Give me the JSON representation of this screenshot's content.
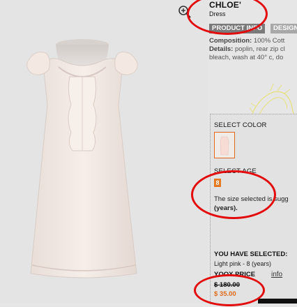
{
  "product": {
    "brand": "CHLOE'",
    "category": "Dress"
  },
  "tabs": {
    "product_info": "PRODUCT INFO",
    "designer": "DESIGNER"
  },
  "details": {
    "composition_label": "Composition:",
    "composition_value": "100% Cott",
    "details_label": "Details:",
    "details_value": "poplin, rear zip cl",
    "care_line": "bleach, wash at 40° c, do"
  },
  "select_color": {
    "label": "SELECT COLOR",
    "swatch_color": "#f0ebe6"
  },
  "select_age": {
    "label": "SELECT AGE",
    "size_value": "8",
    "note_line1": "The size selected is sugg",
    "note_line2": "(years)."
  },
  "selection": {
    "label": "YOU HAVE SELECTED:",
    "summary": "Light pink - 8 (years)"
  },
  "price": {
    "label": "YOOX PRICE",
    "info_link": "info",
    "old_price": "$ 180.00",
    "new_price": "$ 35.00"
  },
  "colors": {
    "accent_orange": "#e06a1a",
    "annotation_red": "#e30b0b",
    "tab_dark": "#7a7a7a",
    "tab_light": "#a8a8a8"
  }
}
